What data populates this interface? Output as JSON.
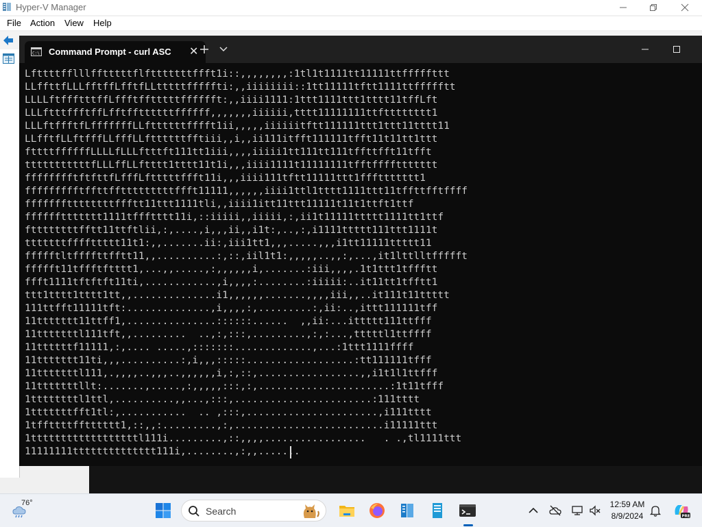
{
  "hyperv": {
    "title": "Hyper-V Manager",
    "menu": [
      "File",
      "Action",
      "View",
      "Help"
    ]
  },
  "terminal": {
    "tab_title": "Command Prompt - curl  ASC",
    "lines": [
      "Lfttttfflllfftttttflftttttttffft1i::,,,,,,,,:1tl1t1111tt11111ttfffffttt",
      "LLffttfLLLfftffLfftfLLtttttfffffti:,,iiiiiiii::1tt11111tftt1111ttffffftt",
      "LLLLftffftttffLffftfftttttfffffft:,,iiii1111:1ttt1111ttt1tttt11tffLft",
      "LLLftttffftffLfftffttttttffffff,,,,,,,iiiiii,tttt11111111ttftttttttt1",
      "LLLftffftfLfffffffLLfttttttfffft1ii,,,,,iiiiiitftt111111ttt1ttt11tttt11",
      "LLfftfLLftfffLLfffLLfttttttfftiii,,i,,ii111itfft111111tfft11t11tt1ttt",
      "fttttffffffLLLLfLLLftttft111tt1iii,,,,iiiii1tt111tt111tffttfft11tfft",
      "tttttttttttfLLLffLLftttt1tttt11t1i,,,iiii1111t11111111tfftffffttttttt",
      "fffffffftftfttfLfffLftttttffft11i,,,iiii111tftt11111ttt1fffttttttt1",
      "ffffffffftffttfftttttttttffft11111,,,,,,iiii1ttl1tttt1111ttt11tffttfftffff",
      "fffffffttttttttffftt11ttt1111tli,,iiii1itt11ttt11111t11t1ttft1ttf",
      "ffffffttttttt1111tffftttt11i,::iiiii,,iiiii,:,ii1t11111ttttt1111tt1ttf",
      "fttttttttfftt11ttftlii,:,....,i,,,ii,,i1t:,..,:,i1111ttttt111ttt1111t",
      "tttttttffffttttt11t1:,,.......ii:,iii1tt1,,,.....,,,i1tt11111ttttt11",
      "ffffftltffffttfftt11,,..........:,::,iil1t1:,,,,,..,,:,...,it1lttlltffffft",
      "ffffft11tffftftttt1,...,,.....,:,,,,,,i,.......:iii,,,,.1t1ttt1tffftt",
      "ffft1111tftftft11ti,............,i,,,,:........:iiiii:..it11tt1tfftt1",
      "ttt1tttt1tttt1tt,,..............i1,,,,,,.......,,,,iii,,..it111t11ttttt",
      "111ttfft11111tft:..............,i,,,,:,.........:,ii:..,ittt111111tff",
      "11ttttttt11ttff1,...............::::::......  ,,ii:...ittttt111ttfff",
      "11tttttttl111tft,,.........  ..,:,:::,.........,:,:...,tttttl1ttffff",
      "11ttttttf11111,:,.... .....,:::::::.............,...:1ttt1111ffff",
      "11ttttttt11ti,,,..........:,i,,,:::::..................:tt111111tfff",
      "11tttttttl111,.,,,,..,,,..,,,,,,i,:,::,.................,,i1t1l1ttfff",
      "11tttttttllt:.......,.....,:,,,,,:::,:,......................:1t11tfff",
      "1ttttttttl1ttl,..........,,...,:::,.......................:111tttt",
      "1tttttttfft1tl:,...........  .. ,:::,......................,i111tttt",
      "1tffttttfftttttt1,::,,:.........,:,.........................i11111ttt",
      "1ttttttttttttttttttl111i.........,::,,,,.................   . .,tl1111ttt",
      "11111111tttttttttttttt111i,........,:,,......."
    ]
  },
  "taskbar": {
    "weather_temp": "76°",
    "search_placeholder": "Search",
    "clock_time": "12:59 AM",
    "clock_date": "8/9/2024"
  }
}
